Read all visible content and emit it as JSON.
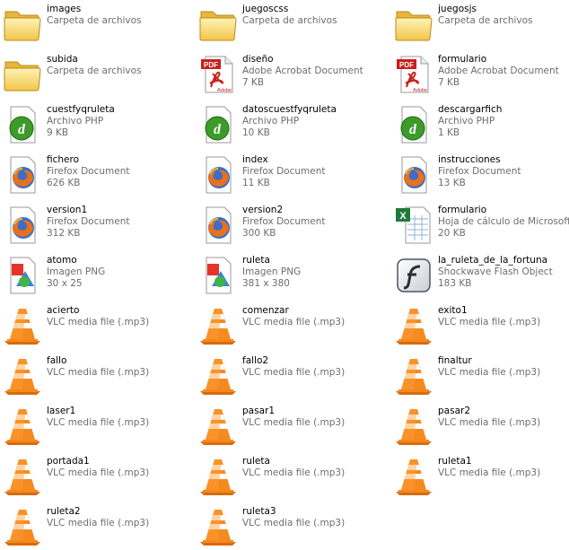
{
  "files": [
    {
      "name": "images",
      "type": "Carpeta de archivos",
      "detail": "",
      "icon": "folder-icon"
    },
    {
      "name": "juegoscss",
      "type": "Carpeta de archivos",
      "detail": "",
      "icon": "folder-icon"
    },
    {
      "name": "juegosjs",
      "type": "Carpeta de archivos",
      "detail": "",
      "icon": "folder-icon"
    },
    {
      "name": "subida",
      "type": "Carpeta de archivos",
      "detail": "",
      "icon": "folder-icon"
    },
    {
      "name": "diseño",
      "type": "Adobe Acrobat Document",
      "detail": "7 KB",
      "icon": "pdf-icon"
    },
    {
      "name": "formulario",
      "type": "Adobe Acrobat Document",
      "detail": "7 KB",
      "icon": "pdf-icon"
    },
    {
      "name": "cuestfyqruleta",
      "type": "Archivo PHP",
      "detail": "9 KB",
      "icon": "dreamweaver-php-icon"
    },
    {
      "name": "datoscuestfyqruleta",
      "type": "Archivo PHP",
      "detail": "10 KB",
      "icon": "dreamweaver-php-icon"
    },
    {
      "name": "descargarfich",
      "type": "Archivo PHP",
      "detail": "1 KB",
      "icon": "dreamweaver-php-icon"
    },
    {
      "name": "fichero",
      "type": "Firefox Document",
      "detail": "626 KB",
      "icon": "firefox-icon"
    },
    {
      "name": "index",
      "type": "Firefox Document",
      "detail": "11 KB",
      "icon": "firefox-icon"
    },
    {
      "name": "instrucciones",
      "type": "Firefox Document",
      "detail": "13 KB",
      "icon": "firefox-icon"
    },
    {
      "name": "version1",
      "type": "Firefox Document",
      "detail": "312 KB",
      "icon": "firefox-icon"
    },
    {
      "name": "version2",
      "type": "Firefox Document",
      "detail": "300 KB",
      "icon": "firefox-icon"
    },
    {
      "name": "formulario",
      "type": "Hoja de cálculo de Microsoft E...",
      "detail": "20 KB",
      "icon": "excel-icon"
    },
    {
      "name": "atomo",
      "type": "Imagen PNG",
      "detail": "30 x 25",
      "icon": "png-image-icon"
    },
    {
      "name": "ruleta",
      "type": "Imagen PNG",
      "detail": "381 x 380",
      "icon": "png-image-icon"
    },
    {
      "name": "la_ruleta_de_la_fortuna",
      "type": "Shockwave Flash Object",
      "detail": "183 KB",
      "icon": "flash-icon"
    },
    {
      "name": "acierto",
      "type": "VLC media file (.mp3)",
      "detail": "",
      "icon": "vlc-cone-icon"
    },
    {
      "name": "comenzar",
      "type": "VLC media file (.mp3)",
      "detail": "",
      "icon": "vlc-cone-icon"
    },
    {
      "name": "exito1",
      "type": "VLC media file (.mp3)",
      "detail": "",
      "icon": "vlc-cone-icon"
    },
    {
      "name": "fallo",
      "type": "VLC media file (.mp3)",
      "detail": "",
      "icon": "vlc-cone-icon"
    },
    {
      "name": "fallo2",
      "type": "VLC media file (.mp3)",
      "detail": "",
      "icon": "vlc-cone-icon"
    },
    {
      "name": "finaltur",
      "type": "VLC media file (.mp3)",
      "detail": "",
      "icon": "vlc-cone-icon"
    },
    {
      "name": "laser1",
      "type": "VLC media file (.mp3)",
      "detail": "",
      "icon": "vlc-cone-icon"
    },
    {
      "name": "pasar1",
      "type": "VLC media file (.mp3)",
      "detail": "",
      "icon": "vlc-cone-icon"
    },
    {
      "name": "pasar2",
      "type": "VLC media file (.mp3)",
      "detail": "",
      "icon": "vlc-cone-icon"
    },
    {
      "name": "portada1",
      "type": "VLC media file (.mp3)",
      "detail": "",
      "icon": "vlc-cone-icon"
    },
    {
      "name": "ruleta",
      "type": "VLC media file (.mp3)",
      "detail": "",
      "icon": "vlc-cone-icon"
    },
    {
      "name": "ruleta1",
      "type": "VLC media file (.mp3)",
      "detail": "",
      "icon": "vlc-cone-icon"
    },
    {
      "name": "ruleta2",
      "type": "VLC media file (.mp3)",
      "detail": "",
      "icon": "vlc-cone-icon"
    },
    {
      "name": "ruleta3",
      "type": "VLC media file (.mp3)",
      "detail": "",
      "icon": "vlc-cone-icon"
    }
  ]
}
